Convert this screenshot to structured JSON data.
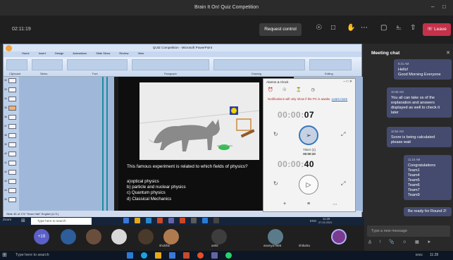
{
  "window": {
    "title": "Brain It On! Quiz Competition",
    "controls": [
      "–",
      "□"
    ]
  },
  "toolbar": {
    "elapsed": "02:11:19",
    "request_control": "Request control",
    "leave": "Leave"
  },
  "ppt": {
    "title": "QUIZ Competition - Microsoft PowerPoint",
    "tabs": [
      "Home",
      "Insert",
      "Design",
      "Animations",
      "Slide Show",
      "Review",
      "View"
    ],
    "groups": [
      "Clipboard",
      "Slides",
      "Font",
      "Paragraph",
      "Drawing",
      "Editing"
    ],
    "thumb_numbers": [
      "32",
      "33",
      "34",
      "35",
      "36",
      "37",
      "38",
      "39",
      "40",
      "41",
      "42",
      "43",
      "44",
      "45"
    ],
    "status": "Slide 36 of 175   \"Team Halt\"   English (U.S.)"
  },
  "slide": {
    "question": "This famous experiment is related to which fields of physics?",
    "options": [
      "a)optical physics",
      "b) particle and nuclear physics",
      "c) Quantum physics",
      "d) Classical Mechanics"
    ]
  },
  "clock": {
    "title": "Alarms & Clock",
    "notice": "Notifications will only show if the PC is awake.",
    "learn_more": "Learn more",
    "timer_top_dim": "00:00:",
    "timer_top_bold": "07",
    "timer_label": "Timer (1)",
    "timer_label_time": "00:00:20",
    "timer_bottom_dim": "00:00:",
    "timer_bottom_bold": "40"
  },
  "inner_taskbar": {
    "search_placeholder": "Type here to search",
    "left_label": "Zoom",
    "lang": "ENG",
    "time": "11:28",
    "date": "07-02-2021"
  },
  "participants": {
    "more_count": "+19",
    "names": [
      "shobhit",
      "ankit",
      "ananya7686",
      "shikaha"
    ]
  },
  "outer_taskbar": {
    "search_placeholder": "Type here to search",
    "lang": "ENG",
    "time": "11:28"
  },
  "chat": {
    "header": "Meeting chat",
    "messages": [
      {
        "time": "8:31 AM",
        "lines": [
          "Hello!",
          "Good Morning Everyone"
        ]
      },
      {
        "time": "10:45 AM",
        "lines": [
          "You all can take ss of the explanation and answers displayed as well to check it later"
        ]
      },
      {
        "time": "10:54 AM",
        "lines": [
          "Score is being calculated please wait"
        ]
      },
      {
        "time": "11:15 AM",
        "lines": [
          "Congratulations",
          "Team1",
          "Team4",
          "Team5",
          "Team6",
          "Team7",
          "Team9"
        ]
      },
      {
        "time": "",
        "lines": [
          "Be ready for Round 2!"
        ]
      }
    ],
    "compose_placeholder": "Type a new message"
  },
  "colors": {
    "leave": "#c4314b",
    "chat_bubble": "#444b6e",
    "timer_ring": "#3a77b7",
    "notice": "#b3261e"
  }
}
